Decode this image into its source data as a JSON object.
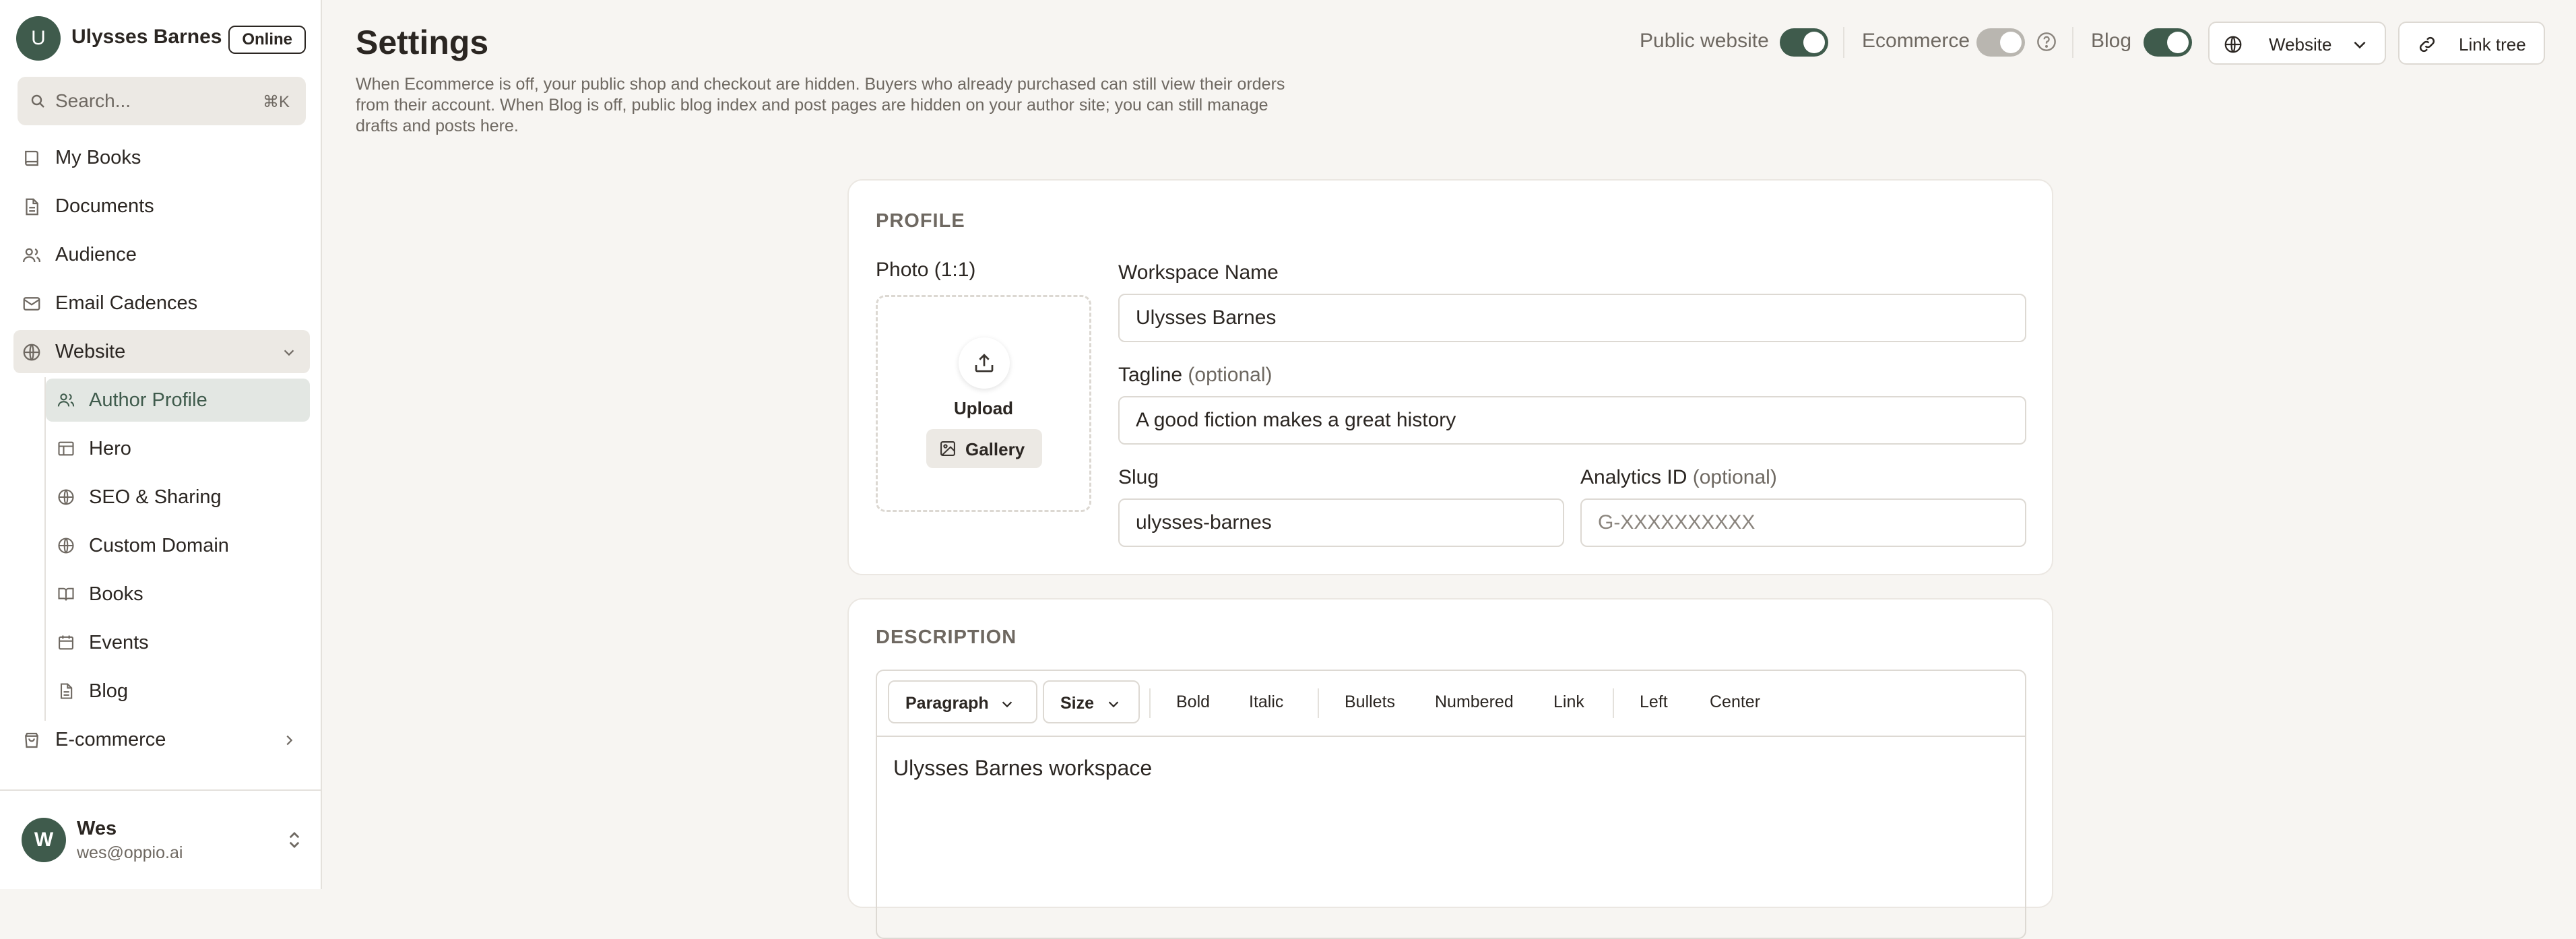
{
  "account": {
    "initial": "U",
    "name": "Ulysses Barnes",
    "status": "Online"
  },
  "search": {
    "placeholder": "Search...",
    "shortcut": "⌘K"
  },
  "sidebar": {
    "items": [
      {
        "label": "My Books",
        "icon": "book-icon"
      },
      {
        "label": "Documents",
        "icon": "document-icon"
      },
      {
        "label": "Audience",
        "icon": "users-icon"
      },
      {
        "label": "Email Cadences",
        "icon": "mail-icon"
      },
      {
        "label": "Website",
        "icon": "globe-icon"
      },
      {
        "label": "E-commerce",
        "icon": "shopping-bag-icon"
      }
    ],
    "website_sub": [
      {
        "label": "Author Profile",
        "icon": "user-icon"
      },
      {
        "label": "Hero",
        "icon": "layout-icon"
      },
      {
        "label": "SEO & Sharing",
        "icon": "globe-icon"
      },
      {
        "label": "Custom Domain",
        "icon": "globe-icon"
      },
      {
        "label": "Books",
        "icon": "open-book-icon"
      },
      {
        "label": "Events",
        "icon": "calendar-icon"
      },
      {
        "label": "Blog",
        "icon": "document-icon"
      }
    ]
  },
  "user": {
    "initial": "W",
    "name": "Wes",
    "email": "wes@oppio.ai"
  },
  "header": {
    "title": "Settings",
    "help": "When Ecommerce is off, your public shop and checkout are hidden. Buyers who already purchased can still view their orders from their account. When Blog is off, public blog index and post pages are hidden on your author site; you can still manage drafts and posts here.",
    "toggles": [
      {
        "label": "Public website",
        "on": true
      },
      {
        "label": "Ecommerce",
        "on": false
      },
      {
        "label": "Blog",
        "on": true
      }
    ],
    "website_btn": "Website",
    "linktree_btn": "Link tree"
  },
  "profile": {
    "section": "PROFILE",
    "photo_label": "Photo (1:1)",
    "upload": "Upload",
    "gallery": "Gallery",
    "workspace_label": "Workspace Name",
    "workspace_value": "Ulysses Barnes",
    "tagline_label": "Tagline",
    "tagline_opt": "(optional)",
    "tagline_value": "A good fiction makes a great history",
    "slug_label": "Slug",
    "slug_value": "ulysses-barnes",
    "analytics_label": "Analytics ID",
    "analytics_opt": "(optional)",
    "analytics_placeholder": "G-XXXXXXXXXX"
  },
  "description": {
    "section": "DESCRIPTION",
    "paragraph": "Paragraph",
    "size": "Size",
    "bold": "Bold",
    "italic": "Italic",
    "bullets": "Bullets",
    "numbered": "Numbered",
    "link": "Link",
    "left": "Left",
    "center": "Center",
    "content": "Ulysses Barnes workspace"
  }
}
